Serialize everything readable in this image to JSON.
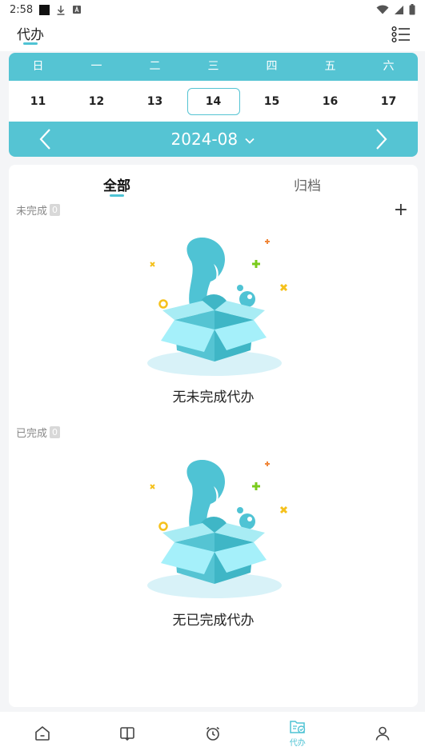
{
  "status": {
    "time": "2:58"
  },
  "header": {
    "title": "代办",
    "menu_icon": "list-menu-icon"
  },
  "calendar": {
    "weekdays": [
      "日",
      "一",
      "二",
      "三",
      "四",
      "五",
      "六"
    ],
    "days": [
      "11",
      "12",
      "13",
      "14",
      "15",
      "16",
      "17"
    ],
    "selected_day": "14",
    "month": "2024-08",
    "accent": "#55c4d3"
  },
  "tabs": [
    {
      "label": "全部",
      "active": true
    },
    {
      "label": "归档",
      "active": false
    }
  ],
  "sections": {
    "incomplete": {
      "label": "未完成",
      "count": "0",
      "empty_text": "无未完成代办"
    },
    "completed": {
      "label": "已完成",
      "count": "0",
      "empty_text": "无已完成代办"
    }
  },
  "add_label": "+",
  "bottom_nav": [
    {
      "icon": "home-icon",
      "label": ""
    },
    {
      "icon": "book-icon",
      "label": ""
    },
    {
      "icon": "alarm-clock-icon",
      "label": ""
    },
    {
      "icon": "todo-folder-icon",
      "label": "代办",
      "active": true
    },
    {
      "icon": "user-icon",
      "label": ""
    }
  ]
}
